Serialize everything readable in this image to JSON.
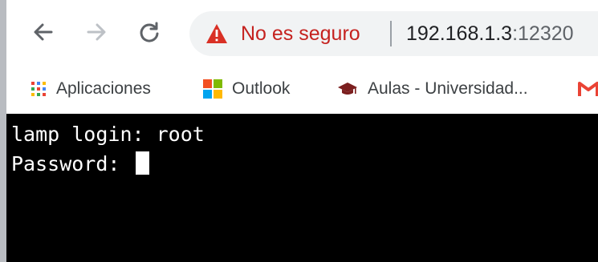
{
  "browser": {
    "security_label": "No es seguro",
    "url_host": "192.168.1.3",
    "url_port": ":12320",
    "colors": {
      "warning": "#d93025",
      "security_text": "#c5221f"
    }
  },
  "bookmarks": [
    {
      "label": "Aplicaciones",
      "icon": "apps-grid-icon"
    },
    {
      "label": "Outlook",
      "icon": "microsoft-logo-icon"
    },
    {
      "label": "Aulas - Universidad...",
      "icon": "graduation-cap-icon"
    },
    {
      "label": "",
      "icon": "gmail-icon"
    }
  ],
  "terminal": {
    "line1": "lamp login: root",
    "line2": "Password: "
  }
}
